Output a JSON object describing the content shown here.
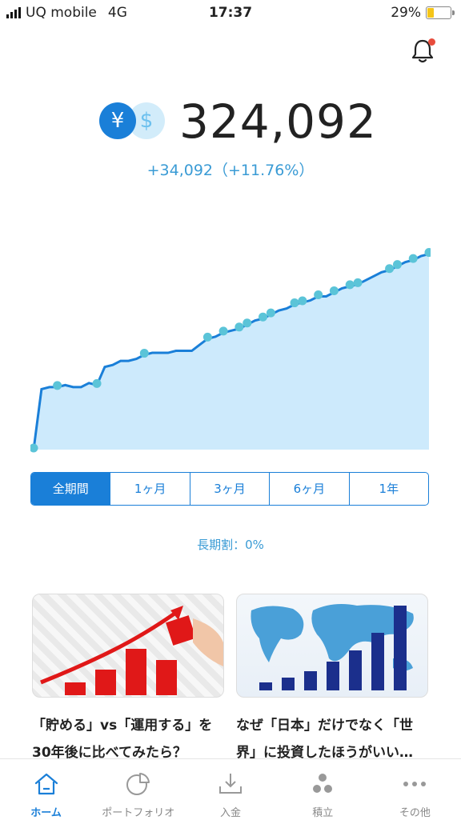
{
  "status_bar": {
    "carrier": "UQ mobile",
    "network": "4G",
    "time": "17:37",
    "battery": "29%",
    "battery_level": 0.29
  },
  "balance": {
    "amount": "324,092",
    "change": "+34,092（+11.76%）",
    "yen_symbol": "¥",
    "usd_symbol": "$"
  },
  "periods": {
    "items": [
      "全期間",
      "1ヶ月",
      "3ヶ月",
      "6ヶ月",
      "1年"
    ],
    "selected": "全期間"
  },
  "long_term_discount": "長期割：0%",
  "articles": [
    {
      "title": "「貯める」vs「運用する」を30年後に比べてみたら？"
    },
    {
      "title": "なぜ「日本」だけでなく「世界」に投資したほうがいい…"
    }
  ],
  "tabs": [
    {
      "label": "ホーム",
      "icon": "home-icon"
    },
    {
      "label": "ポートフォリオ",
      "icon": "pie-chart-icon"
    },
    {
      "label": "入金",
      "icon": "download-icon"
    },
    {
      "label": "積立",
      "icon": "dots-icon"
    },
    {
      "label": "その他",
      "icon": "more-icon"
    }
  ],
  "colors": {
    "accent": "#1a7fd8",
    "text_accent": "#3a9bd5",
    "chart_fill": "#cdeafc",
    "chart_line": "#1a7fd8",
    "marker": "#5bc4d8",
    "notification": "#e74c3c"
  },
  "chart_data": {
    "type": "area",
    "x": [
      0,
      1,
      2,
      3,
      4,
      5,
      6,
      7,
      8,
      9,
      10,
      11,
      12,
      13,
      14,
      15,
      16,
      17,
      18,
      19,
      20,
      21,
      22,
      23,
      24,
      25,
      26,
      27,
      28,
      29,
      30,
      31,
      32,
      33,
      34,
      35,
      36,
      37,
      38,
      39,
      40,
      41,
      42,
      43,
      44,
      45,
      46,
      47,
      48,
      49,
      50
    ],
    "series": [
      {
        "values": [
          0.0,
          0.3,
          0.31,
          0.31,
          0.32,
          0.31,
          0.31,
          0.33,
          0.32,
          0.41,
          0.42,
          0.44,
          0.44,
          0.45,
          0.47,
          0.48,
          0.48,
          0.48,
          0.49,
          0.49,
          0.49,
          0.52,
          0.55,
          0.56,
          0.58,
          0.59,
          0.6,
          0.62,
          0.64,
          0.65,
          0.67,
          0.69,
          0.7,
          0.72,
          0.73,
          0.74,
          0.76,
          0.76,
          0.78,
          0.8,
          0.81,
          0.82,
          0.84,
          0.86,
          0.88,
          0.89,
          0.91,
          0.93,
          0.94,
          0.96,
          0.97
        ]
      }
    ],
    "markers": [
      0,
      3,
      8,
      14,
      22,
      24,
      26,
      27,
      29,
      30,
      33,
      34,
      36,
      38,
      40,
      41,
      45,
      46,
      48,
      50
    ],
    "ylim": [
      0,
      1
    ]
  }
}
